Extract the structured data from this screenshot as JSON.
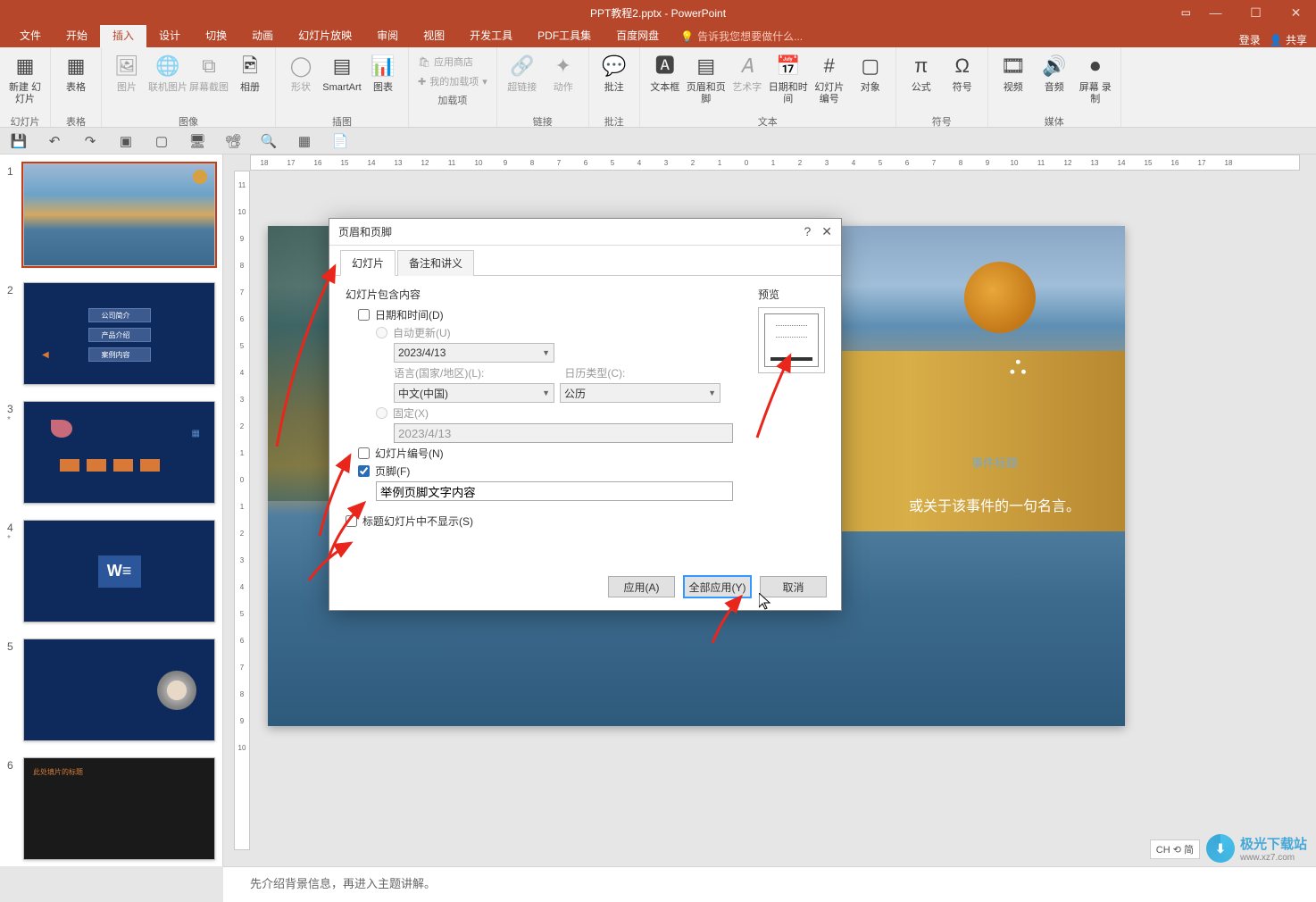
{
  "window": {
    "title": "PPT教程2.pptx - PowerPoint"
  },
  "wincontrols": {
    "opts": "▭",
    "min": "—",
    "max": "☐",
    "close": "✕"
  },
  "tabs": {
    "file": "文件",
    "home": "开始",
    "insert": "插入",
    "design": "设计",
    "transition": "切换",
    "animation": "动画",
    "slideshow": "幻灯片放映",
    "review": "审阅",
    "view": "视图",
    "developer": "开发工具",
    "pdf": "PDF工具集",
    "baidu": "百度网盘",
    "tellme_icon": "💡",
    "tellme": "告诉我您想要做什么...",
    "signin": "登录",
    "share": "共享"
  },
  "ribbon": {
    "g_slides": "幻灯片",
    "new_slide": "新建\n幻灯片",
    "g_tables": "表格",
    "table": "表格",
    "g_images": "图像",
    "picture": "图片",
    "online_pic": "联机图片",
    "screenshot": "屏幕截图",
    "album": "相册",
    "g_illust": "插图",
    "shapes": "形状",
    "smartart": "SmartArt",
    "chart": "图表",
    "g_addins": "加载项",
    "store": "应用商店",
    "myaddins": "我的加载项",
    "g_links": "链接",
    "hyperlink": "超链接",
    "action": "动作",
    "g_comments": "批注",
    "comment": "批注",
    "g_text": "文本",
    "textbox": "文本框",
    "headerfooter": "页眉和页脚",
    "wordart": "艺术字",
    "datetime": "日期和时间",
    "slidenum": "幻灯片\n编号",
    "object": "对象",
    "g_symbols": "符号",
    "equation": "公式",
    "symbol": "符号",
    "g_media": "媒体",
    "video": "视频",
    "audio": "音频",
    "screenrec": "屏幕\n录制"
  },
  "hruler": [
    "18",
    "17",
    "16",
    "15",
    "14",
    "13",
    "12",
    "11",
    "10",
    "9",
    "8",
    "7",
    "6",
    "5",
    "4",
    "3",
    "2",
    "1",
    "0",
    "1",
    "2",
    "3",
    "4",
    "5",
    "6",
    "7",
    "8",
    "9",
    "10",
    "11",
    "12",
    "13",
    "14",
    "15",
    "16",
    "17",
    "18"
  ],
  "vruler": [
    "11",
    "10",
    "9",
    "8",
    "7",
    "6",
    "5",
    "4",
    "3",
    "2",
    "1",
    "0",
    "1",
    "2",
    "3",
    "4",
    "5",
    "6",
    "7",
    "8",
    "9",
    "10"
  ],
  "thumbs": [
    {
      "n": "1",
      "star": ""
    },
    {
      "n": "2",
      "star": ""
    },
    {
      "n": "3",
      "star": "*"
    },
    {
      "n": "4",
      "star": "*"
    },
    {
      "n": "5",
      "star": ""
    },
    {
      "n": "6",
      "star": ""
    }
  ],
  "thumb2_items": [
    "公司简介",
    "产品介绍",
    "案例内容"
  ],
  "thumb6_title": "此处填片的标题",
  "bigslide": {
    "quote": "或关于该事件的一句名言。",
    "placeholder": "事件标题"
  },
  "dialog": {
    "title": "页眉和页脚",
    "help": "?",
    "close": "✕",
    "tab_slide": "幻灯片",
    "tab_notes": "备注和讲义",
    "section_label": "幻灯片包含内容",
    "cb_datetime": "日期和时间(D)",
    "rb_auto": "自动更新(U)",
    "date_value": "2023/4/13",
    "lang_label": "语言(国家/地区)(L):",
    "lang_value": "中文(中国)",
    "cal_label": "日历类型(C):",
    "cal_value": "公历",
    "rb_fixed": "固定(X)",
    "fixed_value": "2023/4/13",
    "cb_slidenum": "幻灯片编号(N)",
    "cb_footer": "页脚(F)",
    "footer_text": "举例页脚文字内容",
    "cb_hidetitle": "标题幻灯片中不显示(S)",
    "preview_label": "预览",
    "btn_apply": "应用(A)",
    "btn_applyall": "全部应用(Y)",
    "btn_cancel": "取消"
  },
  "notes": "先介绍背景信息，再进入主题讲解。",
  "status_chip": "CH ⟲ 简",
  "watermark": {
    "name": "极光下载站",
    "url": "www.xz7.com"
  }
}
